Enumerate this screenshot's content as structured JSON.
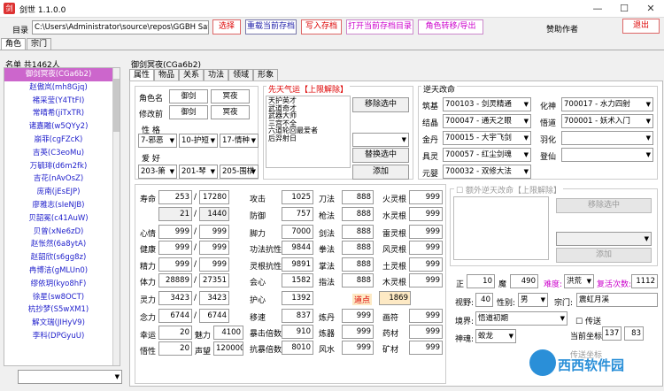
{
  "window": {
    "title": "剑世 1.1.0.0",
    "min": "—",
    "max": "☐",
    "close": "✕"
  },
  "toolbar": {
    "dir_label": "目录",
    "dir_value": "C:\\Users\\Administrator\\source\\repos\\GGBH SaveEd",
    "select": "选择",
    "reload": "重载当前存档",
    "write": "写入存档",
    "open_dir": "打开当前存档目录",
    "transfer": "角色转移/导出",
    "sponsor": "赞助作者",
    "exit": "退出"
  },
  "main_tabs": [
    "角色",
    "宗门"
  ],
  "list": {
    "header": "名单  共1462人",
    "items": [
      "御剑冥夜(CGa6b2)",
      "赵傲岚(mh8Gjq)",
      "褚采莹(Y4TtFI)",
      "常晴希(jiTxTR)",
      "诸嘉雕(w5QYy2)",
      "崩菲(cgFZcK)",
      "吉英(C3eoMu)",
      "万毓琲(d6m2fk)",
      "吉花(nAvOsZ)",
      "庞南(jEsEJP)",
      "廖雅志(sIeNJB)",
      "贝韶冕(c41AuW)",
      "贝曾(xNe6zD)",
      "赵怅然(6a8ytA)",
      "赵韶欣(s6gg8z)",
      "冉博洁(gMLUn0)",
      "缪依玥(kyo8hF)",
      "徐星(sw8OCT)",
      "杭抄梦(S5wXM1)",
      "解文瑞(JIHyV9)",
      "李科(DPGyuU)"
    ]
  },
  "profile": {
    "title": "御剑冥夜(CGa6b2)",
    "tabs": [
      "属性",
      "物品",
      "关系",
      "功法",
      "领域",
      "形象"
    ],
    "name_label": "角色名",
    "first": "御剑",
    "last": "冥夜",
    "former_label": "修改前",
    "former_first": "御剑",
    "former_last": "冥夜",
    "char_label": "性  格",
    "traits": [
      "7-邪恶",
      "10-护短",
      "17-情种"
    ],
    "hobby_label": "爱  好",
    "hobbies": [
      "203-箫",
      "201-琴",
      "205-围棋"
    ]
  },
  "innate": {
    "title": "先天气运【上限解除】",
    "items": [
      "天护英才",
      "武道奇才",
      "武器大师",
      "三宫不全",
      "六道轮回最爱者",
      "后羿射日"
    ],
    "remove": "移除选中",
    "replace": "替换选中",
    "add": "添加"
  },
  "reverse": {
    "title": "逆天改命",
    "rows": [
      [
        "筑基",
        "700103 - 剑灵精通",
        "化神",
        "700017 - 水力四射"
      ],
      [
        "结晶",
        "700047 - 通天之眼",
        "悟道",
        "700001 - 妖术入门"
      ],
      [
        "金丹",
        "700015 - 大宇飞剑",
        "羽化",
        ""
      ],
      [
        "具灵",
        "700057 - 红尘剑魂",
        "登仙",
        ""
      ],
      [
        "元婴",
        "700032 - 双修大法",
        "",
        ""
      ]
    ]
  },
  "extra": {
    "title": "额外逆天改命【上限解除】",
    "remove": "移除选中",
    "add": "添加"
  },
  "stats": {
    "left": [
      [
        "寿命",
        "253",
        "17280"
      ],
      [
        "",
        "21",
        "1440"
      ],
      [
        "心情",
        "999",
        "999"
      ],
      [
        "健康",
        "999",
        "999"
      ],
      [
        "精力",
        "999",
        "999"
      ],
      [
        "体力",
        "28889",
        "27351"
      ],
      [
        "灵力",
        "3423",
        "3423"
      ],
      [
        "念力",
        "6744",
        "6744"
      ]
    ],
    "mid": [
      [
        "攻击",
        "1025"
      ],
      [
        "防御",
        "757"
      ],
      [
        "脚力",
        "7000"
      ],
      [
        "功法抗性",
        "9844"
      ],
      [
        "灵根抗性",
        "9891"
      ],
      [
        "会心",
        "1582"
      ],
      [
        "护心",
        "1392"
      ],
      [
        "移速",
        "837"
      ],
      [
        "暴击倍数",
        "910"
      ],
      [
        "抗暴倍数",
        "8010"
      ]
    ],
    "right": [
      [
        "刀法",
        "888",
        "火灵根",
        "999"
      ],
      [
        "枪法",
        "888",
        "水灵根",
        "999"
      ],
      [
        "剑法",
        "888",
        "雷灵根",
        "999"
      ],
      [
        "拳法",
        "888",
        "风灵根",
        "999"
      ],
      [
        "掌法",
        "888",
        "土灵根",
        "999"
      ],
      [
        "指法",
        "888",
        "木灵根",
        "999"
      ],
      [
        "",
        "",
        "",
        ""
      ],
      [
        "炼丹",
        "999",
        "画符",
        "999"
      ],
      [
        "炼器",
        "999",
        "药材",
        "999"
      ],
      [
        "风水",
        "999",
        "矿材",
        "999"
      ]
    ],
    "luck_label": "幸运",
    "luck": "20",
    "charm_label": "魅力",
    "charm": "4100",
    "wu_label": "悟性",
    "wu": "20",
    "prestige_label": "声望",
    "prestige": "120000",
    "point_label": "道点",
    "point": "1869"
  },
  "side": {
    "zheng_label": "正",
    "zheng": "10",
    "mo_label": "魔",
    "mo": "490",
    "diff_label": "难度:",
    "diff": "洪荒",
    "rep_label": "复活次数:",
    "rep": "1112",
    "vision_label": "视野:",
    "vision": "40",
    "sex_label": "性别:",
    "sex": "男",
    "sect_label": "宗门:",
    "sect": "震虹月溪",
    "realm_label": "境界:",
    "realm": "悟道初期",
    "spirit_label": "神魂:",
    "spirit": "蛟龙",
    "send_label": "传送",
    "coord_label": "当前坐标",
    "x": "137",
    "y": "83",
    "tele_label": "传送坐标"
  },
  "watermark": "西西软件园"
}
